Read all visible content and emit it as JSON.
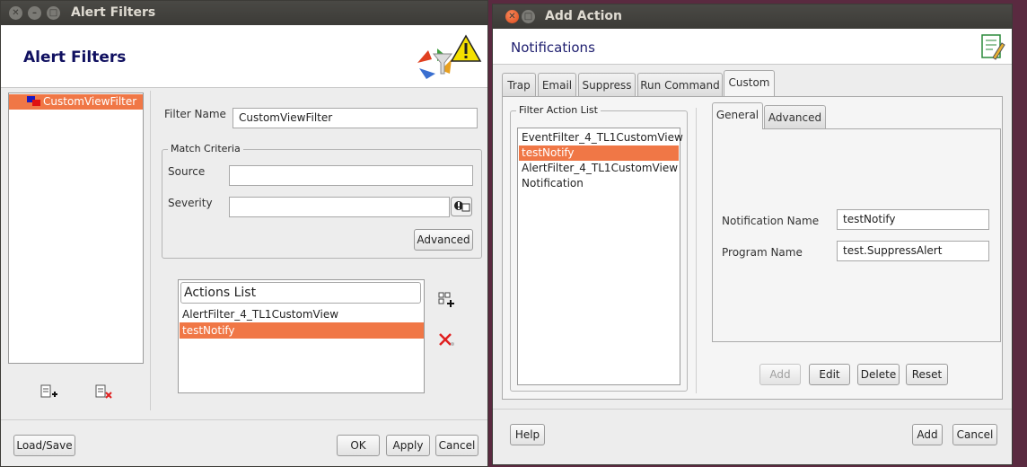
{
  "alert_filters": {
    "window_title": "Alert Filters",
    "header_title": "Alert Filters",
    "tree_items": [
      "CustomViewFilter"
    ],
    "filter_name_label": "Filter Name",
    "filter_name_value": "CustomViewFilter",
    "match_criteria_legend": "Match Criteria",
    "source_label": "Source",
    "source_value": "",
    "severity_label": "Severity",
    "severity_value": "",
    "advanced_button": "Advanced",
    "actions_list_header": "Actions List",
    "actions": [
      "AlertFilter_4_TL1CustomView",
      "testNotify"
    ],
    "selected_action": 1,
    "load_save_button": "Load/Save",
    "ok_button": "OK",
    "apply_button": "Apply",
    "cancel_button": "Cancel"
  },
  "add_action": {
    "window_title": "Add Action",
    "header_title": "Notifications",
    "tabs": [
      "Trap",
      "Email",
      "Suppress",
      "Run Command",
      "Custom"
    ],
    "active_tab": 4,
    "filter_action_list_legend": "Filter Action List",
    "filter_actions": [
      "EventFilter_4_TL1CustomView",
      "testNotify",
      "AlertFilter_4_TL1CustomView",
      "Notification"
    ],
    "selected_filter_action": 1,
    "sub_tabs": [
      "General",
      "Advanced"
    ],
    "active_sub_tab": 0,
    "notification_name_label": "Notification Name",
    "notification_name_value": "testNotify",
    "program_name_label": "Program Name",
    "program_name_value": "test.SuppressAlert",
    "add_button": "Add",
    "edit_button": "Edit",
    "delete_button": "Delete",
    "reset_button": "Reset",
    "help_button": "Help",
    "footer_add_button": "Add",
    "cancel_button": "Cancel"
  },
  "colors": {
    "selection": "#f07746",
    "title_bar": "#3c3b37",
    "desktop": "#5a2a40",
    "header_title": "#101060"
  }
}
